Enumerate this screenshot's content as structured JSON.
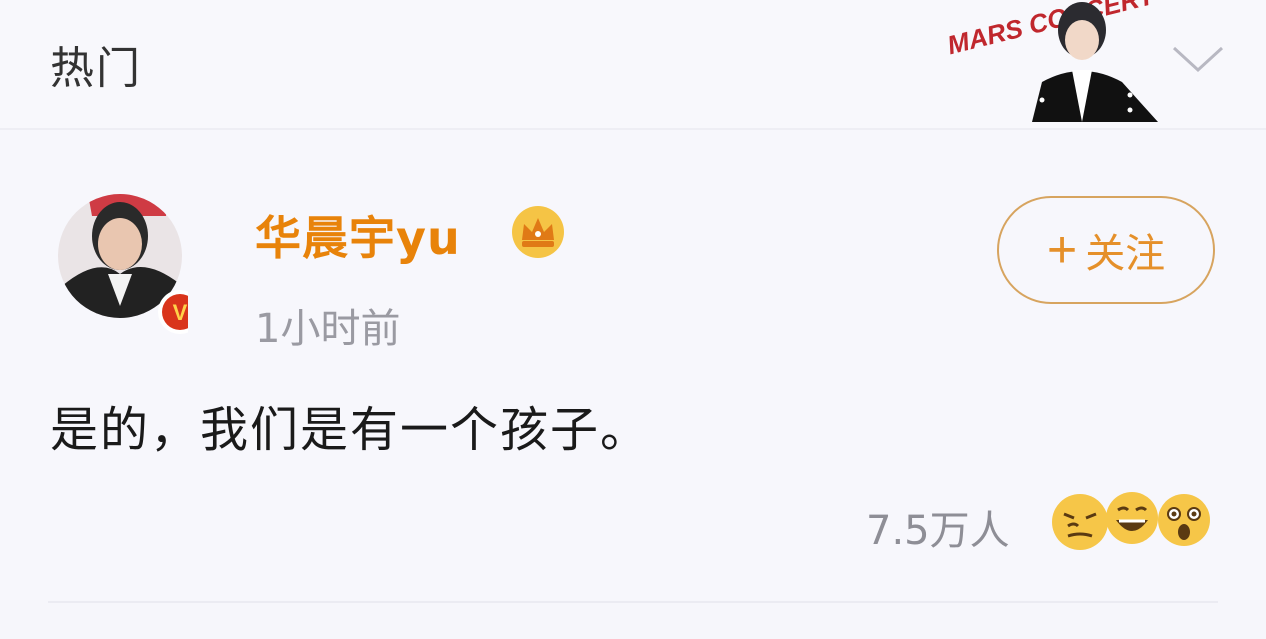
{
  "header": {
    "title": "热门",
    "banner_text": "MARS CONCERT",
    "chevron_icon": "chevron-down-icon"
  },
  "comment": {
    "avatar_icon": "user-avatar",
    "verified_badge": "V",
    "username": "华晨宇yu",
    "crown_icon": "crown-icon",
    "timestamp": "1小时前",
    "follow_label": "关注",
    "follow_plus": "+",
    "text": "是的，我们是有一个孩子。",
    "like_count": "7.5万人",
    "reactions": [
      "smirk-emoji",
      "laugh-emoji",
      "surprised-emoji"
    ]
  },
  "colors": {
    "username": "#e8830a",
    "follow_border": "#d7a45f",
    "follow_text": "#e5902a",
    "badge": "#d9341b"
  }
}
